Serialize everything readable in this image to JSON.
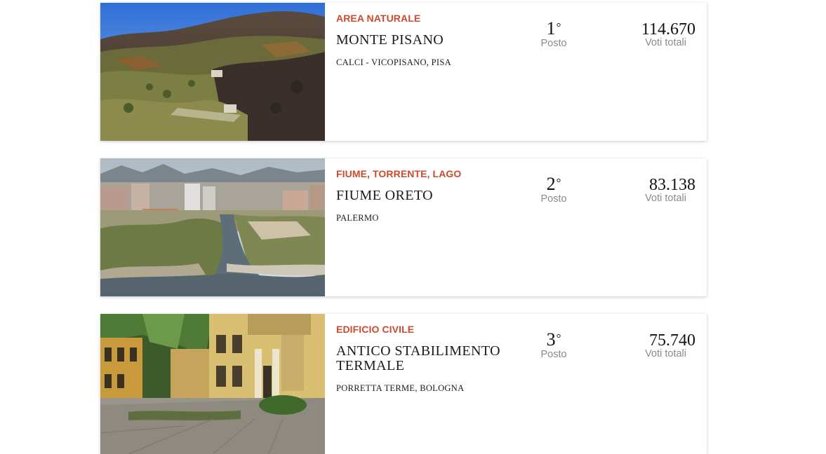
{
  "places": [
    {
      "category": "AREA NATURALE",
      "title": "MONTE PISANO",
      "location": "CALCI - VICOPISANO, PISA",
      "rank": "1",
      "rank_suffix": "°",
      "rank_label": "Posto",
      "votes": "114.670",
      "votes_label": "Voti totali",
      "image": "burnt-hillside-photo"
    },
    {
      "category": "FIUME, TORRENTE, LAGO",
      "title": "FIUME ORETO",
      "location": "PALERMO",
      "rank": "2",
      "rank_suffix": "°",
      "rank_label": "Posto",
      "votes": "83.138",
      "votes_label": "Voti totali",
      "image": "river-mouth-city-photo"
    },
    {
      "category": "EDIFICIO CIVILE",
      "title": "ANTICO STABILIMENTO TERMALE",
      "location": "PORRETTA TERME, BOLOGNA",
      "rank": "3",
      "rank_suffix": "°",
      "rank_label": "Posto",
      "votes": "75.740",
      "votes_label": "Voti totali",
      "image": "thermal-building-photo"
    }
  ],
  "colors": {
    "category": "#cc4a2e",
    "label_gray": "#8a8a8a",
    "text": "#1a1a1a"
  }
}
